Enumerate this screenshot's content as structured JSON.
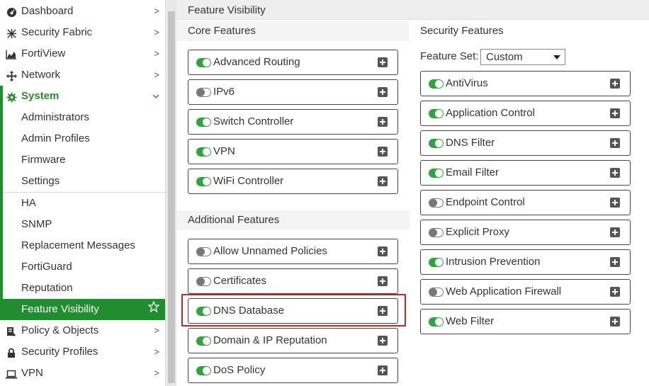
{
  "sidebar": {
    "top_items": [
      {
        "label": "Dashboard",
        "icon": "dashboard-icon"
      },
      {
        "label": "Security Fabric",
        "icon": "security-fabric-icon"
      },
      {
        "label": "FortiView",
        "icon": "fortiview-icon"
      },
      {
        "label": "Network",
        "icon": "network-icon"
      }
    ],
    "system": {
      "label": "System",
      "icon": "gear-icon"
    },
    "system_items": [
      "Administrators",
      "Admin Profiles",
      "Firmware",
      "Settings",
      "HA",
      "SNMP",
      "Replacement Messages",
      "FortiGuard",
      "Reputation"
    ],
    "selected_item": {
      "label": "Feature Visibility",
      "icon": "star-icon"
    },
    "bottom_items": [
      {
        "label": "Policy & Objects",
        "icon": "policy-icon"
      },
      {
        "label": "Security Profiles",
        "icon": "lock-icon"
      },
      {
        "label": "VPN",
        "icon": "laptop-icon"
      }
    ]
  },
  "page": {
    "title": "Feature Visibility"
  },
  "core": {
    "title": "Core Features",
    "features": [
      {
        "label": "Advanced Routing",
        "enabled": true
      },
      {
        "label": "IPv6",
        "enabled": false
      },
      {
        "label": "Switch Controller",
        "enabled": true
      },
      {
        "label": "VPN",
        "enabled": true
      },
      {
        "label": "WiFi Controller",
        "enabled": true
      }
    ]
  },
  "additional": {
    "title": "Additional Features",
    "features": [
      {
        "label": "Allow Unnamed Policies",
        "enabled": false
      },
      {
        "label": "Certificates",
        "enabled": false
      },
      {
        "label": "DNS Database",
        "enabled": true
      },
      {
        "label": "Domain & IP Reputation",
        "enabled": true
      },
      {
        "label": "DoS Policy",
        "enabled": true
      }
    ]
  },
  "security": {
    "title": "Security Features",
    "feature_set_label": "Feature Set:",
    "feature_set_value": "Custom",
    "features": [
      {
        "label": "AntiVirus",
        "enabled": true
      },
      {
        "label": "Application Control",
        "enabled": true
      },
      {
        "label": "DNS Filter",
        "enabled": true
      },
      {
        "label": "Email Filter",
        "enabled": true
      },
      {
        "label": "Endpoint Control",
        "enabled": false
      },
      {
        "label": "Explicit Proxy",
        "enabled": false
      },
      {
        "label": "Intrusion Prevention",
        "enabled": true
      },
      {
        "label": "Web Application Firewall",
        "enabled": false
      },
      {
        "label": "Web Filter",
        "enabled": true
      }
    ]
  },
  "colors": {
    "accent": "#1f8e2e",
    "toggle_on": "#2fa33c",
    "highlight": "#cc2222"
  }
}
